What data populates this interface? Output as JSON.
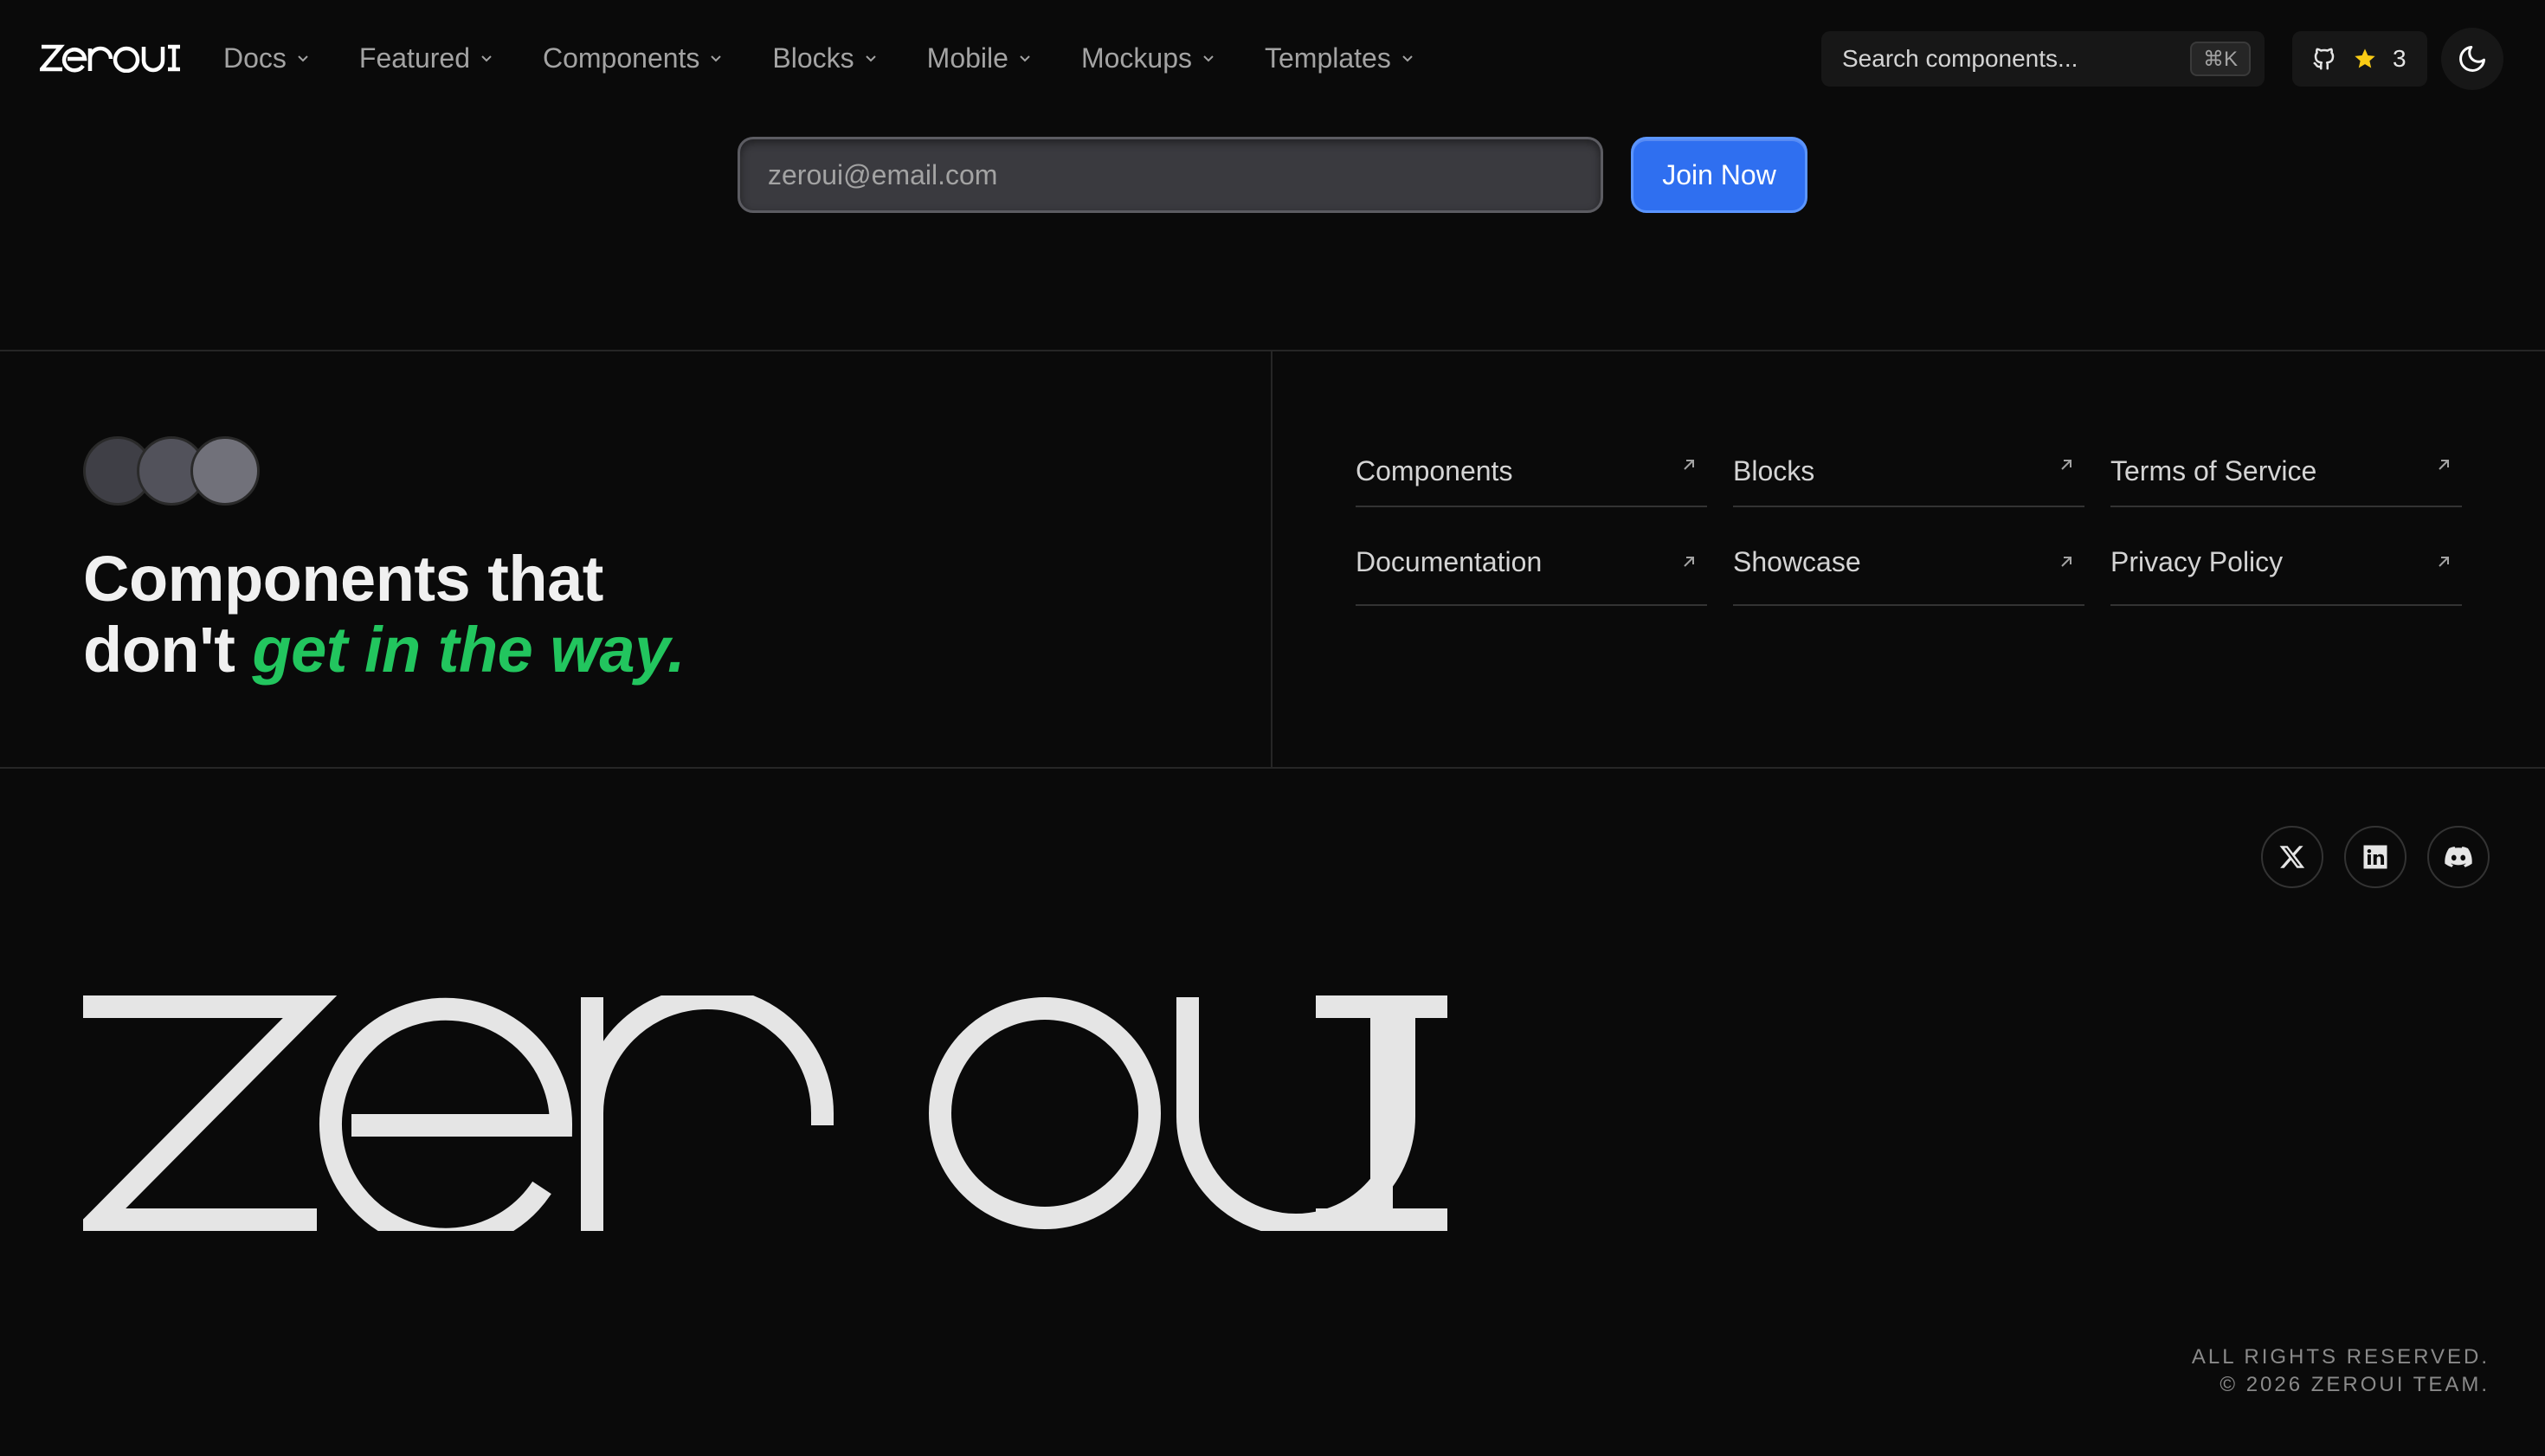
{
  "brand": {
    "name": "zeroui"
  },
  "nav": {
    "items": [
      {
        "label": "Docs"
      },
      {
        "label": "Featured"
      },
      {
        "label": "Components"
      },
      {
        "label": "Blocks"
      },
      {
        "label": "Mobile"
      },
      {
        "label": "Mockups"
      },
      {
        "label": "Templates"
      }
    ],
    "search_placeholder": "Search components...",
    "search_shortcut": "⌘K",
    "github_stars": "3"
  },
  "newsletter": {
    "email_value": "",
    "email_placeholder": "zeroui@email.com",
    "join_label": "Join Now"
  },
  "hero": {
    "tagline_line1": "Components that",
    "tagline_line2_prefix": "don't",
    "tagline_accent": "get in the way."
  },
  "links": [
    {
      "label": "Components"
    },
    {
      "label": "Blocks"
    },
    {
      "label": "Terms of Service"
    },
    {
      "label": "Documentation"
    },
    {
      "label": "Showcase"
    },
    {
      "label": "Privacy Policy"
    }
  ],
  "social": [
    "x-icon",
    "linkedin-icon",
    "discord-icon"
  ],
  "footer": {
    "rights_line1": "ALL RIGHTS RESERVED.",
    "rights_line2": "© 2026 ZEROUI TEAM."
  },
  "colors": {
    "background": "#0a0a0a",
    "accent_green": "#22c55e",
    "primary_blue": "#2f6ff0",
    "star": "#facc15"
  }
}
